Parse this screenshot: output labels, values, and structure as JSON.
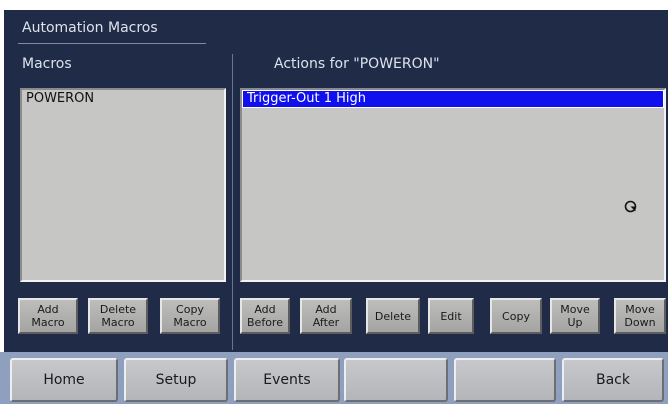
{
  "header": {
    "title": "Automation Macros"
  },
  "macros": {
    "label": "Macros",
    "items": [
      "POWERON"
    ]
  },
  "actions": {
    "label": "Actions for \"POWERON\"",
    "items": [
      "Trigger-Out 1 High"
    ],
    "selected_index": 0
  },
  "macro_buttons": {
    "add": "Add\nMacro",
    "delete": "Delete\nMacro",
    "copy": "Copy\nMacro"
  },
  "action_buttons": {
    "add_before": "Add\nBefore",
    "add_after": "Add\nAfter",
    "delete": "Delete",
    "edit": "Edit",
    "copy": "Copy",
    "move_up": "Move\nUp",
    "move_down": "Move\nDown"
  },
  "nav": {
    "home": "Home",
    "setup": "Setup",
    "events": "Events",
    "blank1": "",
    "blank2": "",
    "back": "Back"
  },
  "colors": {
    "panel_bg": "#1f2b47",
    "list_bg": "#c6c6c4",
    "selection": "#1010ee",
    "nav_bg": "#8fa0bf"
  },
  "icons": {
    "cursor": "busy-cursor-icon"
  }
}
